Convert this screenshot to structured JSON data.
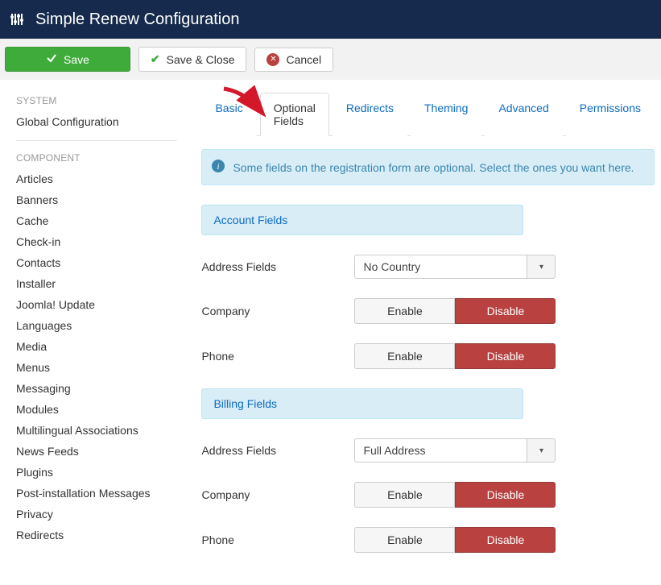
{
  "header": {
    "title": "Simple Renew Configuration"
  },
  "toolbar": {
    "save": "Save",
    "save_close": "Save & Close",
    "cancel": "Cancel"
  },
  "sidebar": {
    "heading_system": "SYSTEM",
    "system_items": [
      "Global Configuration"
    ],
    "heading_component": "COMPONENT",
    "component_items": [
      "Articles",
      "Banners",
      "Cache",
      "Check-in",
      "Contacts",
      "Installer",
      "Joomla! Update",
      "Languages",
      "Media",
      "Menus",
      "Messaging",
      "Modules",
      "Multilingual Associations",
      "News Feeds",
      "Plugins",
      "Post-installation Messages",
      "Privacy",
      "Redirects"
    ]
  },
  "tabs": [
    "Basic",
    "Optional Fields",
    "Redirects",
    "Theming",
    "Advanced",
    "Permissions"
  ],
  "active_tab": 1,
  "alert": "Some fields on the registration form are optional. Select the ones you want here.",
  "sections": {
    "account": {
      "title": "Account Fields",
      "rows": {
        "address": {
          "label": "Address Fields",
          "value": "No Country"
        },
        "company": {
          "label": "Company",
          "enable": "Enable",
          "disable": "Disable"
        },
        "phone": {
          "label": "Phone",
          "enable": "Enable",
          "disable": "Disable"
        }
      }
    },
    "billing": {
      "title": "Billing Fields",
      "rows": {
        "address": {
          "label": "Address Fields",
          "value": "Full Address"
        },
        "company": {
          "label": "Company",
          "enable": "Enable",
          "disable": "Disable"
        },
        "phone": {
          "label": "Phone",
          "enable": "Enable",
          "disable": "Disable"
        }
      }
    }
  }
}
